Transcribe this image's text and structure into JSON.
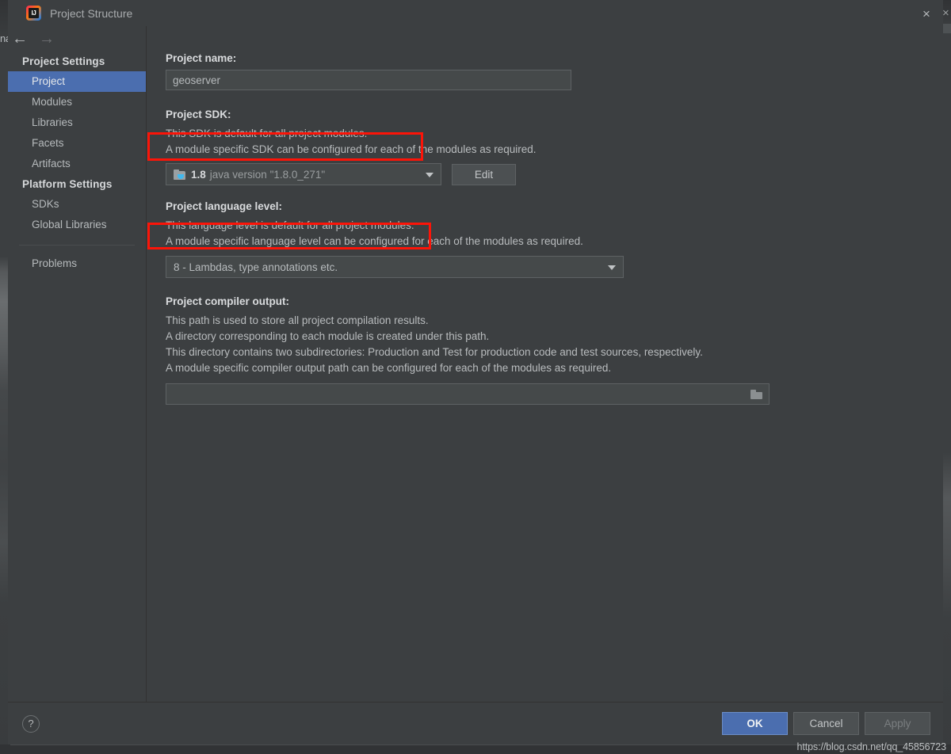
{
  "window": {
    "title": "Project Structure",
    "logo_icon": "intellij-idea-logo",
    "close_icon": "×",
    "parent_close_icon": "×",
    "parent_left_text": "na"
  },
  "nav": {
    "back_icon": "←",
    "forward_icon": "→"
  },
  "sidebar": {
    "groups": [
      {
        "label": "Project Settings",
        "items": [
          {
            "label": "Project",
            "selected": true
          },
          {
            "label": "Modules",
            "selected": false
          },
          {
            "label": "Libraries",
            "selected": false
          },
          {
            "label": "Facets",
            "selected": false
          },
          {
            "label": "Artifacts",
            "selected": false
          }
        ]
      },
      {
        "label": "Platform Settings",
        "items": [
          {
            "label": "SDKs",
            "selected": false
          },
          {
            "label": "Global Libraries",
            "selected": false
          }
        ]
      }
    ],
    "problems": {
      "label": "Problems",
      "selected": false
    }
  },
  "main": {
    "project_name": {
      "label": "Project name:",
      "value": "geoserver"
    },
    "project_sdk": {
      "label": "Project SDK:",
      "desc_line1": "This SDK is default for all project modules.",
      "desc_line2": "A module specific SDK can be configured for each of the modules as required.",
      "icon": "java-sdk-folder-icon",
      "value_name": "1.8",
      "value_version": "java version \"1.8.0_271\"",
      "edit_button": "Edit",
      "highlighted": true
    },
    "language_level": {
      "label": "Project language level:",
      "desc_line1": "This language level is default for all project modules.",
      "desc_line2": "A module specific language level can be configured for each of the modules as required.",
      "value": "8 - Lambdas, type annotations etc.",
      "highlighted": true
    },
    "compiler_output": {
      "label": "Project compiler output:",
      "desc_line1": "This path is used to store all project compilation results.",
      "desc_line2": "A directory corresponding to each module is created under this path.",
      "desc_line3": "This directory contains two subdirectories: Production and Test for production code and test sources, respectively.",
      "desc_line4": "A module specific compiler output path can be configured for each of the modules as required.",
      "value": "",
      "browse_icon": "folder-browse-icon"
    }
  },
  "footer": {
    "help_label": "?",
    "ok": "OK",
    "cancel": "Cancel",
    "apply": "Apply"
  },
  "overlay": {
    "watermark": "https://blog.csdn.net/qq_45856723",
    "highlight_color": "#fc1408"
  }
}
